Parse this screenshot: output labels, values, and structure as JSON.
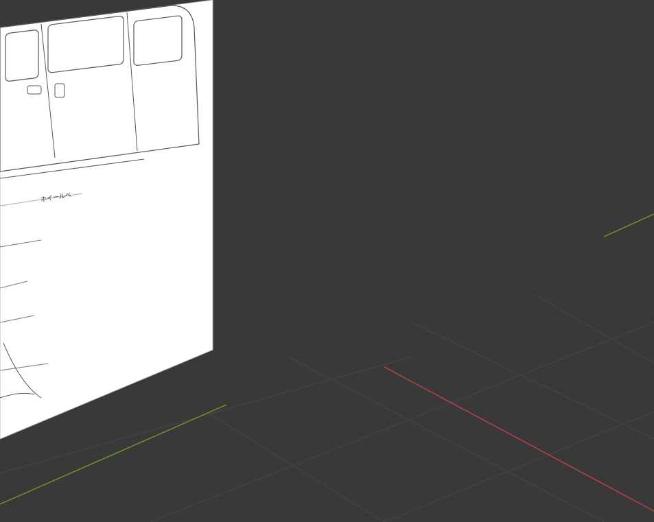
{
  "viewport": {
    "background": "#393939",
    "reference_label": "ホイールベ",
    "axis_colors": {
      "x": "#c4414b",
      "y": "#6f9a2c"
    },
    "origin_color": "#ff9a1a",
    "cursor_color": "#e8e8e8",
    "cursor_accent": "#c8202c",
    "icons": {
      "cursor": "3d-cursor-icon",
      "origin": "object-origin-icon"
    }
  }
}
